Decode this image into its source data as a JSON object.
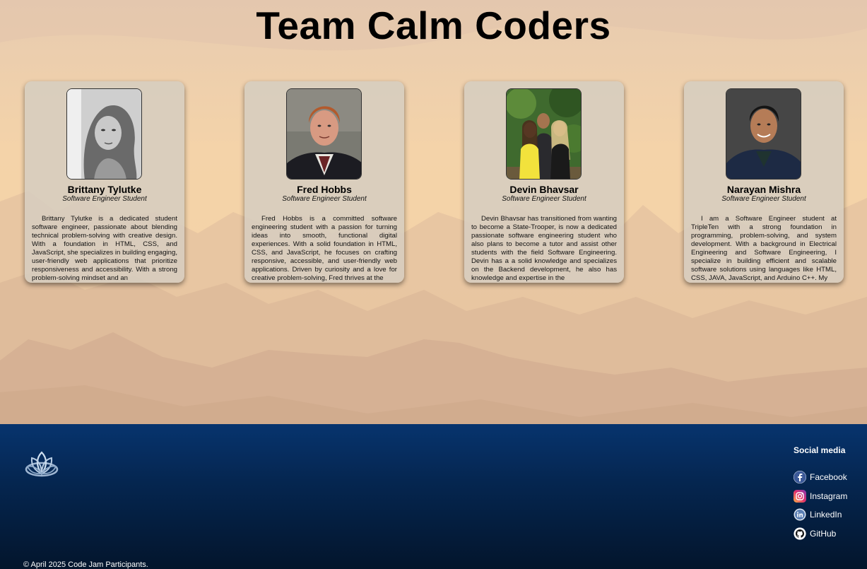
{
  "page": {
    "title": "Team Calm Coders"
  },
  "members": [
    {
      "name": "Brittany Tylutke",
      "role": "Software Engineer Student",
      "bio": "Brittany Tylutke is a dedicated student software engineer, passionate about blending technical problem-solving with creative design. With a foundation in HTML, CSS, and JavaScript, she specializes in building engaging, user-friendly web applications that prioritize responsiveness and accessibility. With a strong problem-solving mindset and an"
    },
    {
      "name": "Fred Hobbs",
      "role": "Software Engineer Student",
      "bio": "Fred Hobbs is a committed software engineering student with a passion for turning ideas into smooth, functional digital experiences. With a solid foundation in HTML, CSS, and JavaScript, he focuses on crafting responsive, accessible, and user-friendly web applications. Driven by curiosity and a love for creative problem-solving, Fred thrives at the"
    },
    {
      "name": "Devin Bhavsar",
      "role": "Software Engineer Student",
      "bio": "Devin Bhavsar has transitioned from wanting to become a State-Trooper, is now a dedicated passionate software engineering student who also plans to become a tutor and assist other students with the field Software Engineering. Devin has a a solid knowledge and specializes on the Backend development, he also has knowledge and expertise in the"
    },
    {
      "name": "Narayan Mishra",
      "role": "Software Engineer Student",
      "bio": "I am a Software Engineer student at TripleTen with a strong foundation in programming, problem-solving, and system development. With a background in Electrical Engineering and Software Engineering, I specialize in building efficient and scalable software solutions using languages like HTML, CSS, JAVA, JavaScript, and Arduino C++. My"
    }
  ],
  "footer": {
    "logo_icon": "lotus-logo-icon",
    "social_title": "Social media",
    "social": [
      {
        "label": "Facebook",
        "icon": "facebook-icon"
      },
      {
        "label": "Instagram",
        "icon": "instagram-icon"
      },
      {
        "label": "LinkedIn",
        "icon": "linkedin-icon"
      },
      {
        "label": "GitHub",
        "icon": "github-icon"
      }
    ],
    "copyright": "© April 2025 Code Jam Participants."
  }
}
